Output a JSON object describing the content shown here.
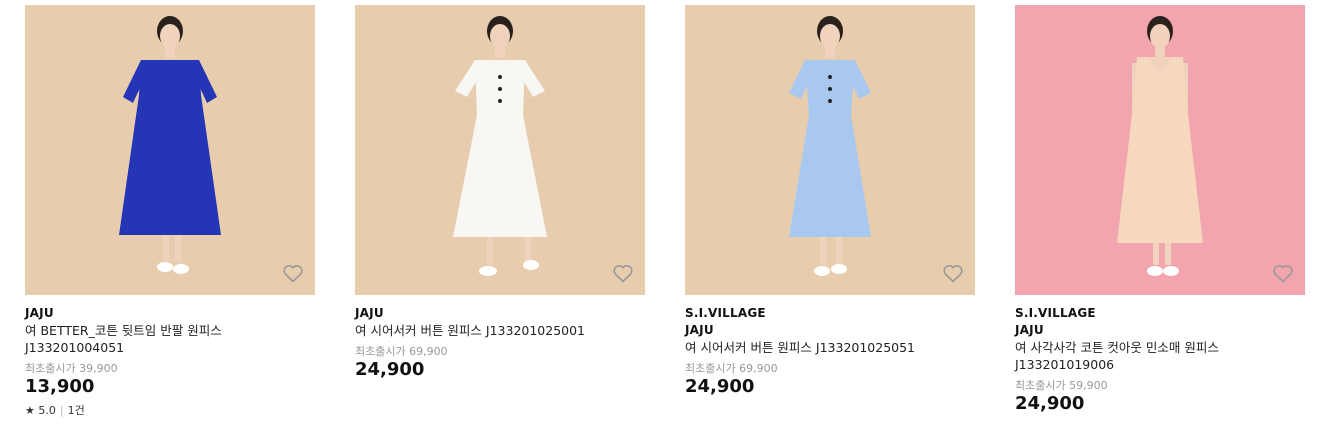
{
  "colors": {
    "bg_beige": "#E7CDAE",
    "bg_pink": "#F2A4AF",
    "dress_blue": "#2436B5",
    "dress_white": "#F8F7F4",
    "dress_lightblue": "#A9C8EF",
    "dress_peach": "#F5D8BE",
    "heart": "#9a9a9a"
  },
  "products": [
    {
      "brands": [
        "JAJU"
      ],
      "name": "여 BETTER_코튼 뒷트임 반팔 원피스 J133201004051",
      "original_price": "최초출시가 39,900",
      "price": "13,900",
      "rating": {
        "star": "★",
        "score": "5.0",
        "reviews": "1건"
      },
      "wishlist_icon": "heart-outline-icon"
    },
    {
      "brands": [
        "JAJU"
      ],
      "name": "여 시어서커 버튼 원피스 J133201025001",
      "original_price": "최초출시가 69,900",
      "price": "24,900",
      "wishlist_icon": "heart-outline-icon"
    },
    {
      "brands": [
        "S.I.VILLAGE",
        "JAJU"
      ],
      "name": "여 시어서커 버튼 원피스 J133201025051",
      "original_price": "최초출시가 69,900",
      "price": "24,900",
      "wishlist_icon": "heart-outline-icon"
    },
    {
      "brands": [
        "S.I.VILLAGE",
        "JAJU"
      ],
      "name": "여 사각사각 코튼 컷아웃 민소매 원피스 J133201019006",
      "original_price": "최초출시가 59,900",
      "price": "24,900",
      "wishlist_icon": "heart-outline-icon"
    }
  ]
}
